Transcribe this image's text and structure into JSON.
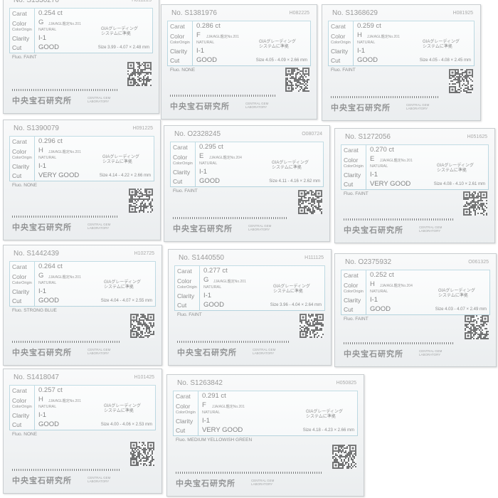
{
  "labels": {
    "carat": "Carat",
    "color": "Color",
    "color_origin": "ColorOrigin",
    "clarity": "Clarity",
    "cut": "Cut"
  },
  "common": {
    "natural": "NATURAL",
    "gia_line1": "GIAグレーディング",
    "gia_line2": "システムに準拠",
    "brand": "中央宝石研究所",
    "brand_en1": "CENTRAL GEM",
    "brand_en2": "LABORATORY"
  },
  "cards": [
    {
      "no": "No. S1330270",
      "code": "H011225",
      "carat": "0.254 ct",
      "color": "G",
      "jja": "JJA/AGL鑑定No.201",
      "clarity": "I-1",
      "cut": "GOOD",
      "size": "Size 3.99 - 4.07 × 2.48 mm",
      "fluo": "Fluo. FAINT"
    },
    {
      "no": "No. S1381976",
      "code": "H082225",
      "carat": "0.286 ct",
      "color": "F",
      "jja": "JJA/AGL鑑定No.201",
      "clarity": "I-1",
      "cut": "GOOD",
      "size": "Size 4.05 - 4.09 × 2.66 mm",
      "fluo": "Fluo. NONE"
    },
    {
      "no": "No. S1368629",
      "code": "H081925",
      "carat": "0.259 ct",
      "color": "H",
      "jja": "JJA/AGL鑑定No.201",
      "clarity": "I-1",
      "cut": "GOOD",
      "size": "Size 4.05 - 4.08 × 2.45 mm",
      "fluo": "Fluo. FAINT"
    },
    {
      "no": "No. S1390079",
      "code": "H091225",
      "carat": "0.296 ct",
      "color": "H",
      "jja": "JJA/AGL鑑定No.201",
      "clarity": "I-1",
      "cut": "VERY GOOD",
      "size": "Size 4.14 - 4.22 × 2.66 mm",
      "fluo": "Fluo. NONE"
    },
    {
      "no": "No. O2328245",
      "code": "O080724",
      "carat": "0.295 ct",
      "color": "E",
      "jja": "JJA/AGL鑑定No.204",
      "clarity": "I-1",
      "cut": "GOOD",
      "size": "Size 4.11 - 4.16 × 2.62 mm",
      "fluo": "Fluo. FAINT"
    },
    {
      "no": "No. S1272056",
      "code": "H051625",
      "carat": "0.270 ct",
      "color": "E",
      "jja": "JJA/AGL鑑定No.201",
      "clarity": "I-1",
      "cut": "VERY GOOD",
      "size": "Size 4.08 - 4.10 × 2.61 mm",
      "fluo": "Fluo. FAINT"
    },
    {
      "no": "No. S1442439",
      "code": "H102725",
      "carat": "0.264 ct",
      "color": "G",
      "jja": "JJA/AGL鑑定No.201",
      "clarity": "I-1",
      "cut": "GOOD",
      "size": "Size 4.04 - 4.07 × 2.55 mm",
      "fluo": "Fluo. STRONG BLUE"
    },
    {
      "no": "No. S1440550",
      "code": "H111125",
      "carat": "0.277 ct",
      "color": "G",
      "jja": "JJA/AGL鑑定No.201",
      "clarity": "I-1",
      "cut": "GOOD",
      "size": "Size 3.96 - 4.04 × 2.64 mm",
      "fluo": "Fluo. FAINT"
    },
    {
      "no": "No. O2375932",
      "code": "O061325",
      "carat": "0.252 ct",
      "color": "H",
      "jja": "JJA/AGL鑑定No.204",
      "clarity": "I-1",
      "cut": "GOOD",
      "size": "Size 4.03 - 4.07 × 2.49 mm",
      "fluo": "Fluo. FAINT"
    },
    {
      "no": "No. S1418047",
      "code": "H101425",
      "carat": "0.257 ct",
      "color": "H",
      "jja": "JJA/AGL鑑定No.201",
      "clarity": "I-1",
      "cut": "GOOD",
      "size": "Size 4.00 - 4.06 × 2.53 mm",
      "fluo": "Fluo. NONE"
    },
    {
      "no": "No. S1263842",
      "code": "H050825",
      "carat": "0.291 ct",
      "color": "F",
      "jja": "JJA/AGL鑑定No.201",
      "clarity": "I-1",
      "cut": "VERY GOOD",
      "size": "Size 4.18 - 4.23 × 2.66 mm",
      "fluo": "Fluo. MEDIUM YELLOWISH GREEN"
    }
  ]
}
